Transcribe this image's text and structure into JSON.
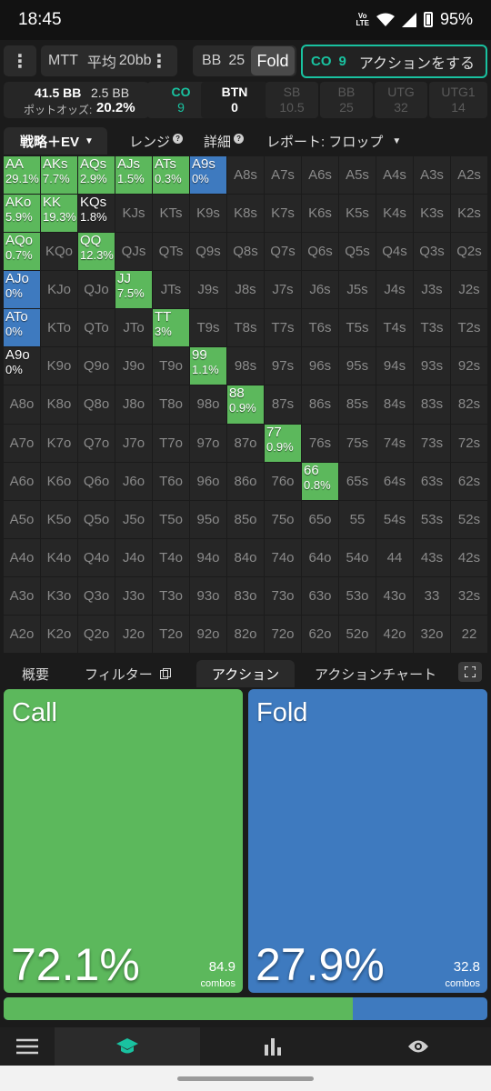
{
  "status": {
    "time": "18:45",
    "volte": "Vo LTE",
    "battery": "95%"
  },
  "top": {
    "format": "MTT",
    "stack_label": "平均",
    "stack_value": "20bb",
    "bb_label": "BB",
    "bb_value": "25",
    "fold_label": "Fold",
    "co_label": "CO",
    "co_value": "9",
    "action_label": "アクションをする"
  },
  "info": {
    "pot_bb": "41.5 BB",
    "bet_bb": "2.5 BB",
    "pot_odds_label": "ポットオッズ:",
    "pot_odds_value": "20.2%"
  },
  "positions": [
    {
      "name": "CO",
      "value": "9",
      "state": "active"
    },
    {
      "name": "BTN",
      "value": "0",
      "state": "current"
    },
    {
      "name": "SB",
      "value": "10.5",
      "state": "dim"
    },
    {
      "name": "BB",
      "value": "25",
      "state": "dim"
    },
    {
      "name": "UTG",
      "value": "32",
      "state": "dim"
    },
    {
      "name": "UTG1",
      "value": "14",
      "state": "dim"
    }
  ],
  "tabs": {
    "strategy": "戦略＋EV",
    "range": "レンジ",
    "detail": "詳細",
    "report": "レポート: フロップ"
  },
  "grid": [
    [
      "AA",
      "AKs",
      "AQs",
      "AJs",
      "ATs",
      "A9s",
      "A8s",
      "A7s",
      "A6s",
      "A5s",
      "A4s",
      "A3s",
      "A2s"
    ],
    [
      "AKo",
      "KK",
      "KQs",
      "KJs",
      "KTs",
      "K9s",
      "K8s",
      "K7s",
      "K6s",
      "K5s",
      "K4s",
      "K3s",
      "K2s"
    ],
    [
      "AQo",
      "KQo",
      "QQ",
      "QJs",
      "QTs",
      "Q9s",
      "Q8s",
      "Q7s",
      "Q6s",
      "Q5s",
      "Q4s",
      "Q3s",
      "Q2s"
    ],
    [
      "AJo",
      "KJo",
      "QJo",
      "JJ",
      "JTs",
      "J9s",
      "J8s",
      "J7s",
      "J6s",
      "J5s",
      "J4s",
      "J3s",
      "J2s"
    ],
    [
      "ATo",
      "KTo",
      "QTo",
      "JTo",
      "TT",
      "T9s",
      "T8s",
      "T7s",
      "T6s",
      "T5s",
      "T4s",
      "T3s",
      "T2s"
    ],
    [
      "A9o",
      "K9o",
      "Q9o",
      "J9o",
      "T9o",
      "99",
      "98s",
      "97s",
      "96s",
      "95s",
      "94s",
      "93s",
      "92s"
    ],
    [
      "A8o",
      "K8o",
      "Q8o",
      "J8o",
      "T8o",
      "98o",
      "88",
      "87s",
      "86s",
      "85s",
      "84s",
      "83s",
      "82s"
    ],
    [
      "A7o",
      "K7o",
      "Q7o",
      "J7o",
      "T7o",
      "97o",
      "87o",
      "77",
      "76s",
      "75s",
      "74s",
      "73s",
      "72s"
    ],
    [
      "A6o",
      "K6o",
      "Q6o",
      "J6o",
      "T6o",
      "96o",
      "86o",
      "76o",
      "66",
      "65s",
      "64s",
      "63s",
      "62s"
    ],
    [
      "A5o",
      "K5o",
      "Q5o",
      "J5o",
      "T5o",
      "95o",
      "85o",
      "75o",
      "65o",
      "55",
      "54s",
      "53s",
      "52s"
    ],
    [
      "A4o",
      "K4o",
      "Q4o",
      "J4o",
      "T4o",
      "94o",
      "84o",
      "74o",
      "64o",
      "54o",
      "44",
      "43s",
      "42s"
    ],
    [
      "A3o",
      "K3o",
      "Q3o",
      "J3o",
      "T3o",
      "93o",
      "83o",
      "73o",
      "63o",
      "53o",
      "43o",
      "33",
      "32s"
    ],
    [
      "A2o",
      "K2o",
      "Q2o",
      "J2o",
      "T2o",
      "92o",
      "82o",
      "72o",
      "62o",
      "52o",
      "42o",
      "32o",
      "22"
    ]
  ],
  "highlights": [
    {
      "r": 0,
      "c": 0,
      "pct": "29.1%",
      "color": "green"
    },
    {
      "r": 0,
      "c": 1,
      "pct": "7.7%",
      "color": "green"
    },
    {
      "r": 0,
      "c": 2,
      "pct": "2.9%",
      "color": "green"
    },
    {
      "r": 0,
      "c": 3,
      "pct": "1.5%",
      "color": "green"
    },
    {
      "r": 0,
      "c": 4,
      "pct": "0.3%",
      "color": "green"
    },
    {
      "r": 0,
      "c": 5,
      "pct": "0%",
      "color": "blue"
    },
    {
      "r": 1,
      "c": 0,
      "pct": "5.9%",
      "color": "green"
    },
    {
      "r": 1,
      "c": 1,
      "pct": "19.3%",
      "color": "green"
    },
    {
      "r": 1,
      "c": 2,
      "pct": "1.8%",
      "color": "dark"
    },
    {
      "r": 2,
      "c": 0,
      "pct": "0.7%",
      "color": "green"
    },
    {
      "r": 2,
      "c": 2,
      "pct": "12.3%",
      "color": "green"
    },
    {
      "r": 3,
      "c": 0,
      "pct": "0%",
      "color": "blue"
    },
    {
      "r": 3,
      "c": 3,
      "pct": "7.5%",
      "color": "green"
    },
    {
      "r": 4,
      "c": 0,
      "pct": "0%",
      "color": "blue"
    },
    {
      "r": 4,
      "c": 4,
      "pct": "3%",
      "color": "green"
    },
    {
      "r": 5,
      "c": 0,
      "pct": "0%",
      "color": "dark"
    },
    {
      "r": 5,
      "c": 5,
      "pct": "1.1%",
      "color": "green"
    },
    {
      "r": 6,
      "c": 6,
      "pct": "0.9%",
      "color": "green"
    },
    {
      "r": 7,
      "c": 7,
      "pct": "0.9%",
      "color": "green"
    },
    {
      "r": 8,
      "c": 8,
      "pct": "0.8%",
      "color": "green"
    }
  ],
  "lower_tabs": {
    "overview": "概要",
    "filter": "フィルター",
    "action": "アクション",
    "action_chart": "アクションチャート"
  },
  "actions": {
    "call": {
      "label": "Call",
      "pct": "72.1%",
      "combos": "84.9",
      "combos_label": "combos",
      "color": "#5cb85c"
    },
    "fold": {
      "label": "Fold",
      "pct": "27.9%",
      "combos": "32.8",
      "combos_label": "combos",
      "color": "#3e7abf"
    }
  },
  "call_fraction": 0.721,
  "nav": [
    "menu-icon",
    "learn-icon",
    "stats-icon",
    "view-icon"
  ]
}
